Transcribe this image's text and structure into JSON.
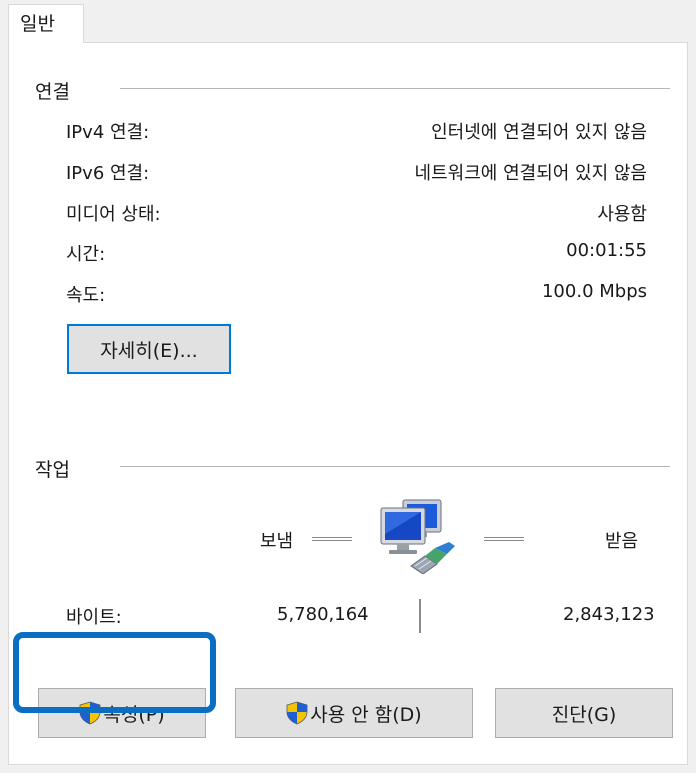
{
  "tab": {
    "label": "일반"
  },
  "connection": {
    "title": "연결",
    "rows": [
      {
        "label": "IPv4 연결:",
        "value": "인터넷에 연결되어 있지 않음"
      },
      {
        "label": "IPv6 연결:",
        "value": "네트워크에 연결되어 있지 않음"
      },
      {
        "label": "미디어 상태:",
        "value": "사용함"
      },
      {
        "label": "시간:",
        "value": "00:01:55"
      },
      {
        "label": "속도:",
        "value": "100.0 Mbps"
      }
    ],
    "details_button": "자세히(E)..."
  },
  "activity": {
    "title": "작업",
    "sent_label": "보냄",
    "received_label": "받음",
    "bytes_label": "바이트:",
    "bytes_sent": "5,780,164",
    "bytes_received": "2,843,123"
  },
  "buttons": {
    "properties": "속성(P)",
    "disable": "사용 안 함(D)",
    "diagnose": "진단(G)"
  },
  "icons": {
    "network": "network-computers-icon",
    "shield": "uac-shield-icon"
  },
  "colors": {
    "accent": "#0078d7",
    "highlight": "#0a6fc2"
  }
}
